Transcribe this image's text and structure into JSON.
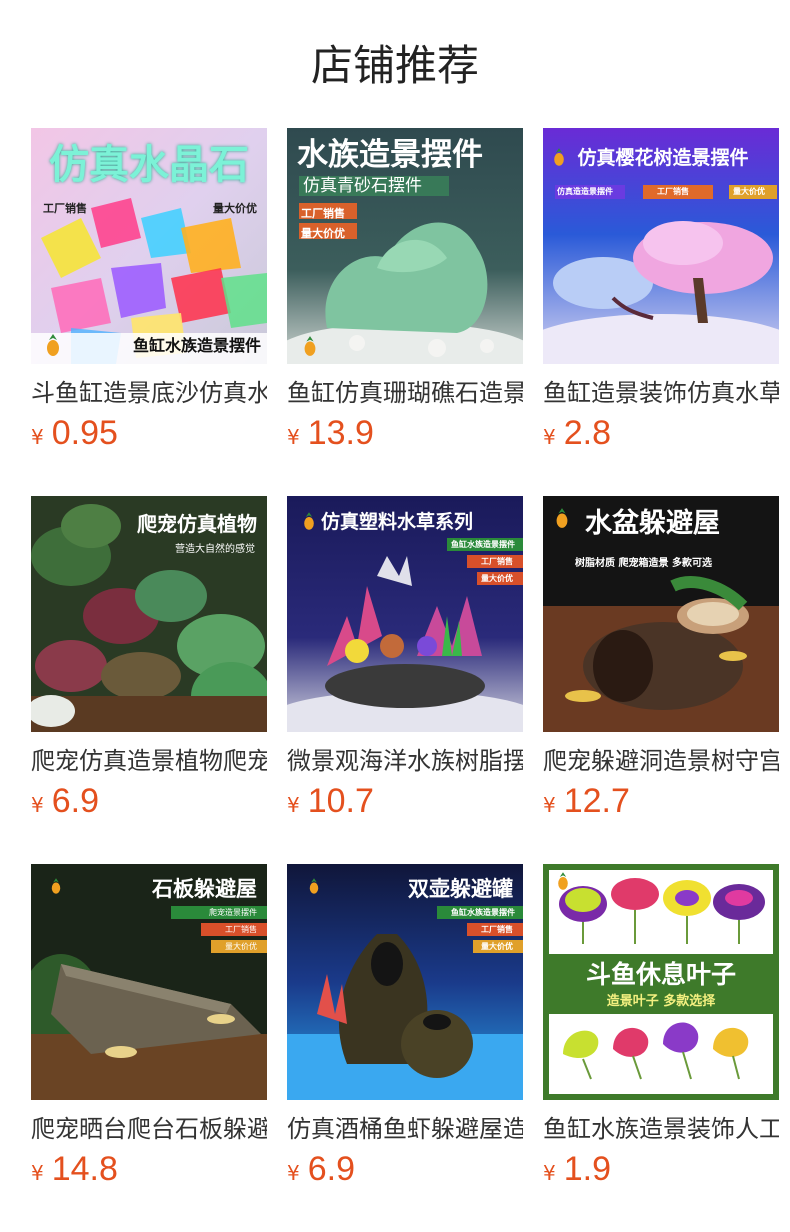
{
  "page": {
    "title": "店铺推荐"
  },
  "currency_symbol": "¥",
  "products": [
    {
      "name": "斗鱼缸造景底沙仿真水晶石",
      "price": "0.95",
      "image": {
        "headline": "仿真水晶石",
        "tags": [
          "工厂销售",
          "量大价优"
        ],
        "footer": "鱼缸水族造景摆件",
        "icon": "pineapple-logo-icon"
      }
    },
    {
      "name": "鱼缸仿真珊瑚礁石造景摆件",
      "price": "13.9",
      "image": {
        "headline": "水族造景摆件",
        "subline": "仿真青砂石摆件",
        "tags": [
          "工厂销售",
          "量大价优"
        ],
        "icon": "pineapple-logo-icon"
      }
    },
    {
      "name": "鱼缸造景装饰仿真水草樱花树",
      "price": "2.8",
      "image": {
        "headline": "仿真樱花树造景摆件",
        "tags": [
          "仿真造造景摆件",
          "工厂销售",
          "量大价优"
        ],
        "icon": "pineapple-logo-icon"
      }
    },
    {
      "name": "爬宠仿真造景植物爬宠箱",
      "price": "6.9",
      "image": {
        "headline": "爬宠仿真植物",
        "subline": "营造大自然的感觉"
      }
    },
    {
      "name": "微景观海洋水族树脂摆件",
      "price": "10.7",
      "image": {
        "headline": "仿真塑料水草系列",
        "tags": [
          "鱼缸水族造景摆件",
          "工厂销售",
          "量大价优"
        ],
        "icon": "pineapple-logo-icon"
      }
    },
    {
      "name": "爬宠躲避洞造景树守宫",
      "price": "12.7",
      "image": {
        "headline": "水盆躲避屋",
        "subline": "树脂材质 爬宠箱造景 多款可选",
        "icon": "pineapple-logo-icon"
      }
    },
    {
      "name": "爬宠晒台爬台石板躲避屋",
      "price": "14.8",
      "image": {
        "headline": "石板躲避屋",
        "tags": [
          "爬宠造景摆件",
          "工厂销售",
          "量大价优"
        ],
        "icon": "pineapple-logo-icon"
      }
    },
    {
      "name": "仿真酒桶鱼虾躲避屋造景",
      "price": "6.9",
      "image": {
        "headline": "双壶躲避罐",
        "tags": [
          "鱼缸水族造景摆件",
          "工厂销售",
          "量大价优"
        ],
        "icon": "pineapple-logo-icon"
      }
    },
    {
      "name": "鱼缸水族造景装饰人工叶子",
      "price": "1.9",
      "image": {
        "headline": "斗鱼休息叶子",
        "subline": "造景叶子 多款选择",
        "icon": "pineapple-logo-icon"
      }
    }
  ],
  "colors": {
    "price": "#e4501e",
    "title": "#222222",
    "name": "#333333"
  }
}
